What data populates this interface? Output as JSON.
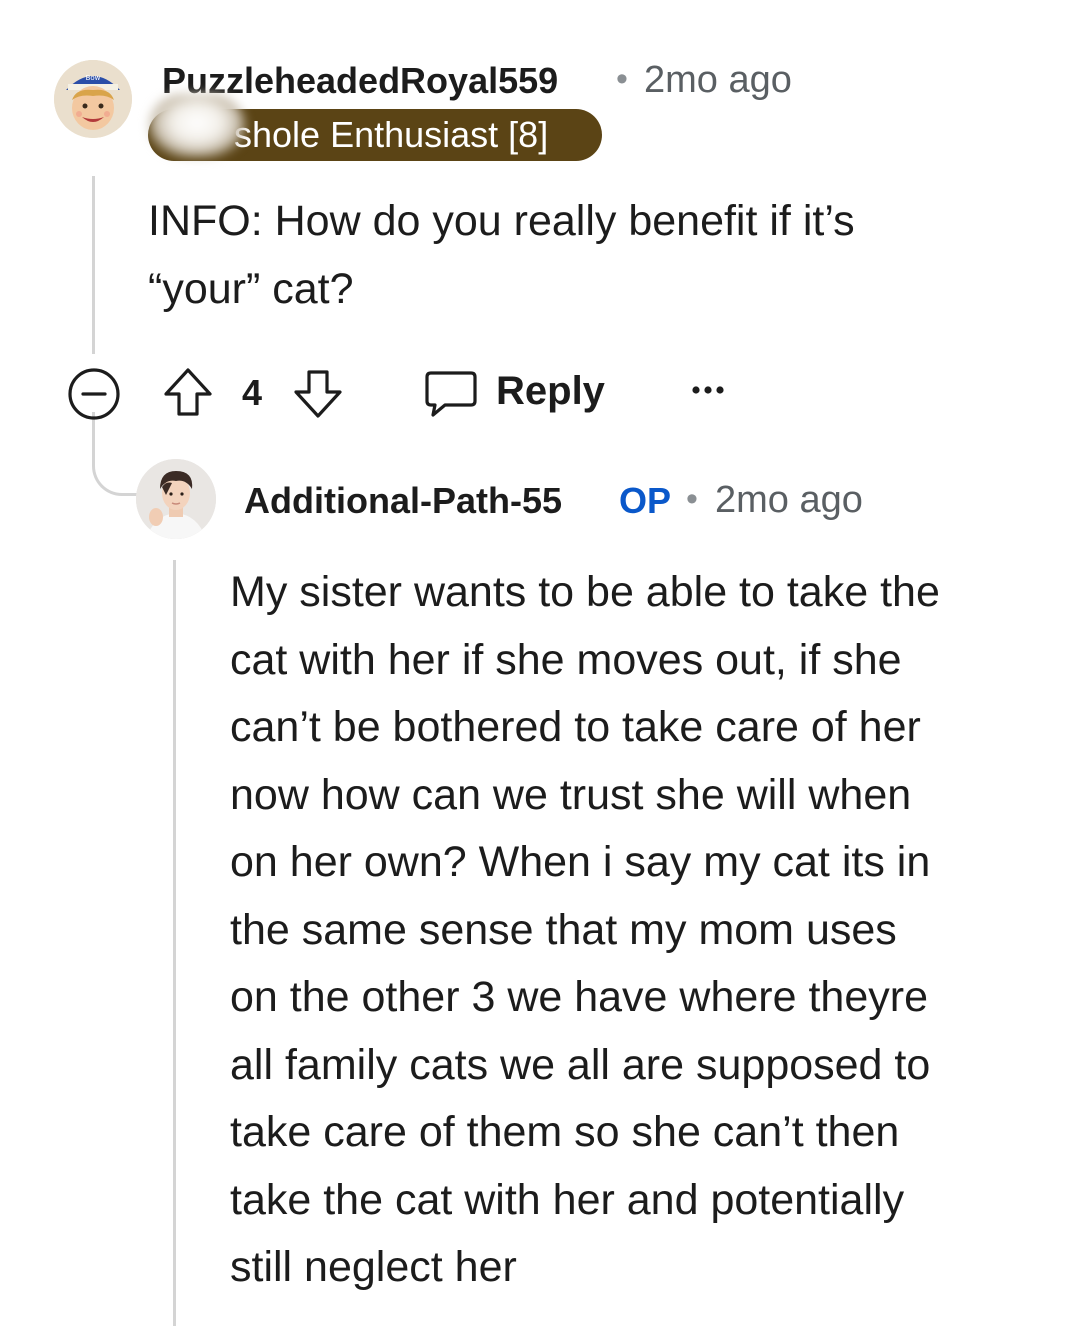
{
  "comments": [
    {
      "username": "PuzzleheadedRoyal559",
      "timestamp": "2mo ago",
      "flair": "shole Enthusiast [8]",
      "flair_color": "#5b4415",
      "body": "INFO: How do you really benefit if it’s\n“your” cat?",
      "score": "4",
      "avatar_icon": "cartoon-boy-avatar"
    },
    {
      "username": "Additional-Path-55",
      "op_badge": "OP",
      "timestamp": "2mo ago",
      "body": "My sister wants to be able to take the\ncat with her if she moves out, if she\ncan’t be bothered to take care of her\nnow how can we trust she will when\non her own? When i say my cat its in\nthe same sense that my mom uses\non the other 3 we have where theyre\nall family cats we all are supposed to\ntake care of them so she can’t then\ntake the cat with her and potentially\nstill neglect her",
      "avatar_icon": "profile-photo-avatar"
    }
  ],
  "actions": {
    "reply_label": "Reply"
  },
  "colors": {
    "op_badge": "#0a58ca",
    "thread_line": "#d4d4d4",
    "meta_text": "#5a5f63"
  }
}
